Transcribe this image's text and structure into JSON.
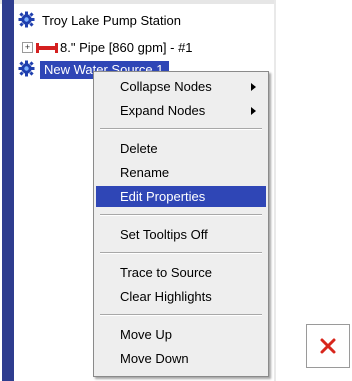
{
  "tree": {
    "pump_station": {
      "label": "Troy Lake Pump Station",
      "icon": "gear-icon"
    },
    "pipe": {
      "label": "8.\" Pipe [860 gpm] - #1",
      "icon": "pipe-icon",
      "expander": "+"
    },
    "water_source": {
      "label": "New Water Source 1",
      "icon": "gear-icon",
      "selected": true
    }
  },
  "context_menu": {
    "items": [
      {
        "label": "Collapse Nodes",
        "submenu": true
      },
      {
        "label": "Expand Nodes",
        "submenu": true
      },
      {
        "label": "Delete"
      },
      {
        "label": "Rename"
      },
      {
        "label": "Edit Properties",
        "highlighted": true
      },
      {
        "label": "Set Tooltips Off"
      },
      {
        "label": "Trace to Source"
      },
      {
        "label": "Clear Highlights"
      },
      {
        "label": "Move Up"
      },
      {
        "label": "Move Down"
      }
    ]
  },
  "colors": {
    "selection": "#2f46b6",
    "tree_border": "#2e3d8f",
    "pipe_icon": "#d42020",
    "menu_background": "#eeeeee",
    "broken_image_x": "#d8261c"
  },
  "broken_image": {
    "icon": "broken-image-icon"
  }
}
